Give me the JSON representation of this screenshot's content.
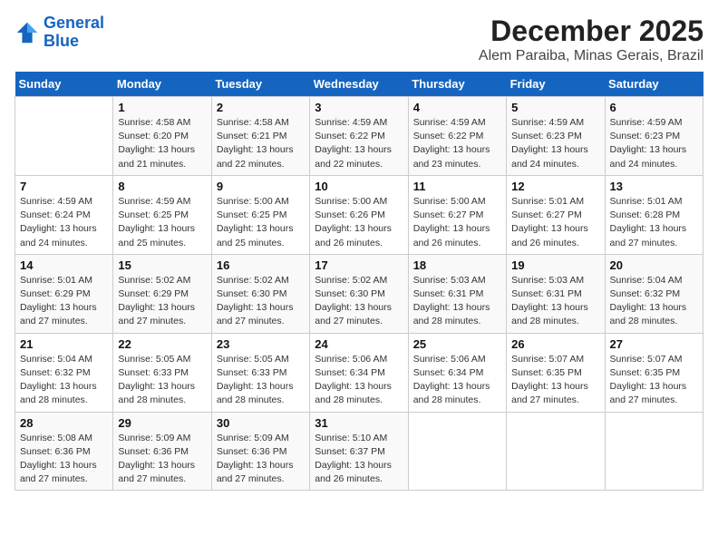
{
  "header": {
    "logo_line1": "General",
    "logo_line2": "Blue",
    "title": "December 2025",
    "subtitle": "Alem Paraiba, Minas Gerais, Brazil"
  },
  "weekdays": [
    "Sunday",
    "Monday",
    "Tuesday",
    "Wednesday",
    "Thursday",
    "Friday",
    "Saturday"
  ],
  "weeks": [
    [
      {
        "day": "",
        "info": ""
      },
      {
        "day": "1",
        "info": "Sunrise: 4:58 AM\nSunset: 6:20 PM\nDaylight: 13 hours\nand 21 minutes."
      },
      {
        "day": "2",
        "info": "Sunrise: 4:58 AM\nSunset: 6:21 PM\nDaylight: 13 hours\nand 22 minutes."
      },
      {
        "day": "3",
        "info": "Sunrise: 4:59 AM\nSunset: 6:22 PM\nDaylight: 13 hours\nand 22 minutes."
      },
      {
        "day": "4",
        "info": "Sunrise: 4:59 AM\nSunset: 6:22 PM\nDaylight: 13 hours\nand 23 minutes."
      },
      {
        "day": "5",
        "info": "Sunrise: 4:59 AM\nSunset: 6:23 PM\nDaylight: 13 hours\nand 24 minutes."
      },
      {
        "day": "6",
        "info": "Sunrise: 4:59 AM\nSunset: 6:23 PM\nDaylight: 13 hours\nand 24 minutes."
      }
    ],
    [
      {
        "day": "7",
        "info": "Sunrise: 4:59 AM\nSunset: 6:24 PM\nDaylight: 13 hours\nand 24 minutes."
      },
      {
        "day": "8",
        "info": "Sunrise: 4:59 AM\nSunset: 6:25 PM\nDaylight: 13 hours\nand 25 minutes."
      },
      {
        "day": "9",
        "info": "Sunrise: 5:00 AM\nSunset: 6:25 PM\nDaylight: 13 hours\nand 25 minutes."
      },
      {
        "day": "10",
        "info": "Sunrise: 5:00 AM\nSunset: 6:26 PM\nDaylight: 13 hours\nand 26 minutes."
      },
      {
        "day": "11",
        "info": "Sunrise: 5:00 AM\nSunset: 6:27 PM\nDaylight: 13 hours\nand 26 minutes."
      },
      {
        "day": "12",
        "info": "Sunrise: 5:01 AM\nSunset: 6:27 PM\nDaylight: 13 hours\nand 26 minutes."
      },
      {
        "day": "13",
        "info": "Sunrise: 5:01 AM\nSunset: 6:28 PM\nDaylight: 13 hours\nand 27 minutes."
      }
    ],
    [
      {
        "day": "14",
        "info": "Sunrise: 5:01 AM\nSunset: 6:29 PM\nDaylight: 13 hours\nand 27 minutes."
      },
      {
        "day": "15",
        "info": "Sunrise: 5:02 AM\nSunset: 6:29 PM\nDaylight: 13 hours\nand 27 minutes."
      },
      {
        "day": "16",
        "info": "Sunrise: 5:02 AM\nSunset: 6:30 PM\nDaylight: 13 hours\nand 27 minutes."
      },
      {
        "day": "17",
        "info": "Sunrise: 5:02 AM\nSunset: 6:30 PM\nDaylight: 13 hours\nand 27 minutes."
      },
      {
        "day": "18",
        "info": "Sunrise: 5:03 AM\nSunset: 6:31 PM\nDaylight: 13 hours\nand 28 minutes."
      },
      {
        "day": "19",
        "info": "Sunrise: 5:03 AM\nSunset: 6:31 PM\nDaylight: 13 hours\nand 28 minutes."
      },
      {
        "day": "20",
        "info": "Sunrise: 5:04 AM\nSunset: 6:32 PM\nDaylight: 13 hours\nand 28 minutes."
      }
    ],
    [
      {
        "day": "21",
        "info": "Sunrise: 5:04 AM\nSunset: 6:32 PM\nDaylight: 13 hours\nand 28 minutes."
      },
      {
        "day": "22",
        "info": "Sunrise: 5:05 AM\nSunset: 6:33 PM\nDaylight: 13 hours\nand 28 minutes."
      },
      {
        "day": "23",
        "info": "Sunrise: 5:05 AM\nSunset: 6:33 PM\nDaylight: 13 hours\nand 28 minutes."
      },
      {
        "day": "24",
        "info": "Sunrise: 5:06 AM\nSunset: 6:34 PM\nDaylight: 13 hours\nand 28 minutes."
      },
      {
        "day": "25",
        "info": "Sunrise: 5:06 AM\nSunset: 6:34 PM\nDaylight: 13 hours\nand 28 minutes."
      },
      {
        "day": "26",
        "info": "Sunrise: 5:07 AM\nSunset: 6:35 PM\nDaylight: 13 hours\nand 27 minutes."
      },
      {
        "day": "27",
        "info": "Sunrise: 5:07 AM\nSunset: 6:35 PM\nDaylight: 13 hours\nand 27 minutes."
      }
    ],
    [
      {
        "day": "28",
        "info": "Sunrise: 5:08 AM\nSunset: 6:36 PM\nDaylight: 13 hours\nand 27 minutes."
      },
      {
        "day": "29",
        "info": "Sunrise: 5:09 AM\nSunset: 6:36 PM\nDaylight: 13 hours\nand 27 minutes."
      },
      {
        "day": "30",
        "info": "Sunrise: 5:09 AM\nSunset: 6:36 PM\nDaylight: 13 hours\nand 27 minutes."
      },
      {
        "day": "31",
        "info": "Sunrise: 5:10 AM\nSunset: 6:37 PM\nDaylight: 13 hours\nand 26 minutes."
      },
      {
        "day": "",
        "info": ""
      },
      {
        "day": "",
        "info": ""
      },
      {
        "day": "",
        "info": ""
      }
    ]
  ]
}
